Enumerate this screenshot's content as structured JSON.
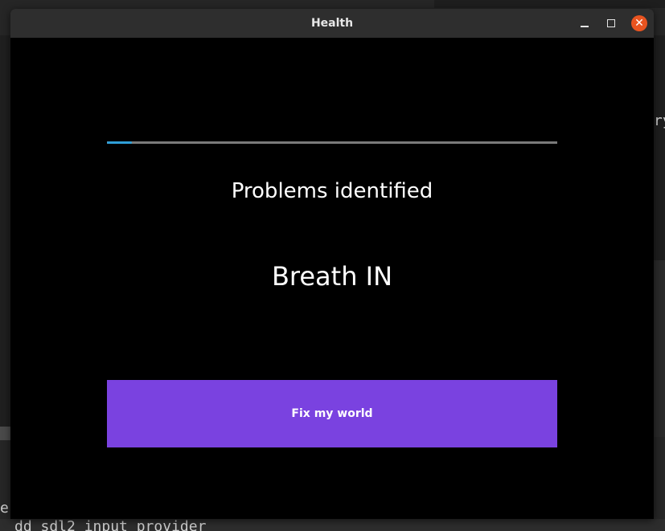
{
  "window": {
    "title": "Health"
  },
  "progress": {
    "fraction": 0.055,
    "color": "#2f9fd8"
  },
  "main": {
    "heading": "Problems identified",
    "instruction": "Breath IN",
    "action_label": "Fix my world"
  },
  "background": {
    "code_fragments": [
      "ry",
      "e",
      "dd sdl2 input provider"
    ]
  },
  "colors": {
    "accent": "#7a42e0",
    "close_button": "#e95420"
  },
  "icons": {
    "minimize": "minimize-icon",
    "maximize": "maximize-icon",
    "close": "close-icon"
  }
}
